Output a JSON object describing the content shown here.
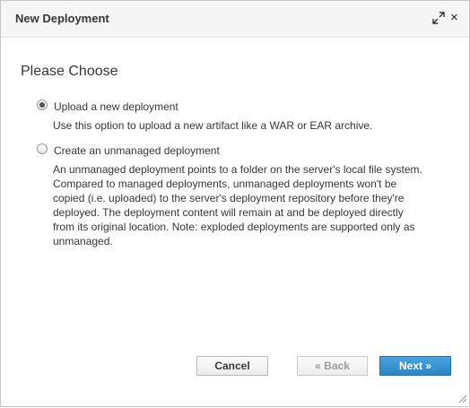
{
  "dialog": {
    "title": "New Deployment",
    "close_symbol": "×"
  },
  "main": {
    "heading": "Please Choose",
    "options": [
      {
        "label": "Upload a new deployment",
        "checked": true,
        "description_lines": [
          "Use this option to upload a new artifact like a WAR or EAR archive."
        ]
      },
      {
        "label": "Create an unmanaged deployment",
        "checked": false,
        "description_lines": [
          "An unmanaged deployment points to a folder on the server's local file system.",
          "Compared to managed deployments, unmanaged deployments won't be",
          "copied (i.e. uploaded) to the server's deployment repository before they're",
          "deployed. The deployment content will remain at and be deployed directly",
          "from its original location. Note: exploded deployments are supported only as",
          "unmanaged."
        ]
      }
    ]
  },
  "footer": {
    "cancel_label": "Cancel",
    "back_label": "« Back",
    "next_label": "Next »"
  },
  "colors": {
    "primary": "#2a86c7",
    "header_bg": "#f5f5f5",
    "text": "#363636"
  },
  "icons": {
    "maximize": "maximize-icon",
    "close": "close-icon",
    "resize": "resize-grip-icon"
  }
}
